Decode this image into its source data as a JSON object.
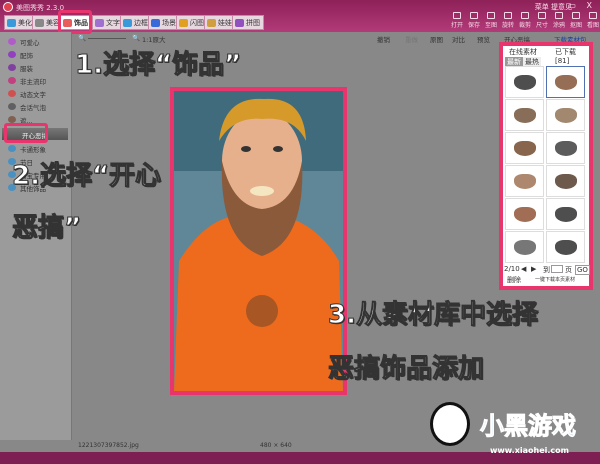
{
  "app": {
    "title": "美图秀秀 2.3.0",
    "top_links": "菜单  提意见",
    "window_controls": "_ ▭ X"
  },
  "tabs": [
    "美化",
    "美容",
    "饰品",
    "文字",
    "边框",
    "场景",
    "闪图",
    "娃娃",
    "拼图"
  ],
  "tools": [
    "打开",
    "保存",
    "至图",
    "旋转",
    "裁剪",
    "尺寸",
    "涂鸦",
    "抠图",
    "看图"
  ],
  "toolbar": {
    "zoom_label": "1:1原大",
    "undo": "撤销",
    "redo": "重做",
    "original": "原图",
    "compare": "对比",
    "preview": "预览"
  },
  "sidebar": {
    "items": [
      "可爱心",
      "配饰",
      "服装",
      "非主流印",
      "动态文字",
      "会话气泡",
      "遮..."
    ],
    "selected": "开心恶搞",
    "items_after": [
      "卡通形象",
      "节日",
      "淘宝专用",
      "其他饰品"
    ]
  },
  "panel": {
    "title": "开心恶搞",
    "download_pack": "下载素材包",
    "tab_online": "在线素材",
    "tab_downloaded": "已下载[81]",
    "sort_new": "最新",
    "sort_hot": "最热",
    "page": "2/10",
    "goto": "到",
    "page_unit": "页",
    "go": "GO",
    "delete": "删除",
    "download_all": "一键下载本页素材"
  },
  "status": {
    "filename": "1221307397852.jpg",
    "dimensions": "480 × 640"
  },
  "annotations": {
    "step1": "1.选择“饰品”",
    "step2a": "2.选择“开心",
    "step2b": "恶搞”",
    "step3a": "3.从素材库中选择",
    "step3b": "恶搞饰品添加"
  },
  "watermark": {
    "name": "小黑游戏",
    "url": "www.xiaohei.com"
  },
  "colors": {
    "accent": "#e8356e",
    "titlebar": "#9c2a62"
  }
}
